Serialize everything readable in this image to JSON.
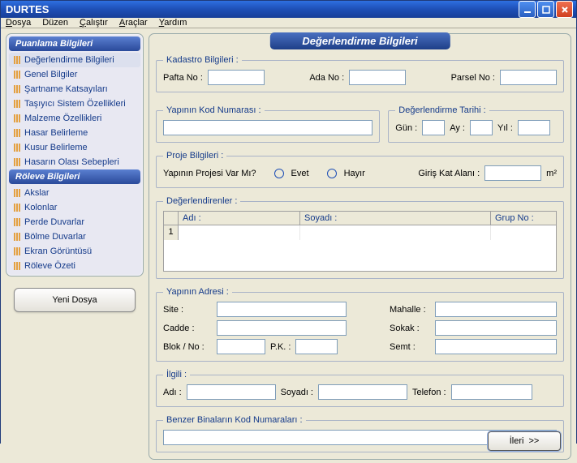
{
  "window": {
    "title": "DURTES"
  },
  "menu": [
    "osya",
    "Düzen",
    "alıştır",
    "raçlar",
    "ardım"
  ],
  "sidebar": {
    "groups": [
      {
        "title": "Puanlama Bilgileri",
        "items": [
          "Değerlendirme Bilgileri",
          "Genel Bilgiler",
          "Şartname Katsayıları",
          "Taşıyıcı Sistem Özellikleri",
          "Malzeme Özellikleri",
          "Hasar Belirleme",
          "Kusur Belirleme",
          "Hasarın Olası Sebepleri"
        ]
      },
      {
        "title": "Röleve Bilgileri",
        "items": [
          "Akslar",
          "Kolonlar",
          "Perde Duvarlar",
          "Bölme Duvarlar",
          "Ekran Görüntüsü",
          "Röleve Özeti"
        ]
      }
    ],
    "new_button": "Yeni Dosya"
  },
  "main": {
    "title": "Değerlendirme Bilgileri",
    "kadastro": {
      "legend": "Kadastro Bilgileri :",
      "pafta": "Pafta No :",
      "ada": "Ada No :",
      "parsel": "Parsel No :"
    },
    "yapikod": {
      "legend": "Yapının Kod Numarası :"
    },
    "tarih": {
      "legend": "Değerlendirme Tarihi :",
      "gun": "Gün :",
      "ay": "Ay :",
      "yil": "Yıl :"
    },
    "proje": {
      "legend": "Proje Bilgileri :",
      "question": "Yapının Projesi Var Mı?",
      "evet": "Evet",
      "hayir": "Hayır",
      "giris_kat": "Giriş Kat Alanı :",
      "unit": "m²"
    },
    "degerlendirenler": {
      "legend": "Değerlendirenler :",
      "cols": [
        "Adı :",
        "Soyadı :",
        "Grup No :"
      ],
      "row": "1"
    },
    "adres": {
      "legend": "Yapının Adresi :",
      "site": "Site :",
      "mahalle": "Mahalle :",
      "cadde": "Cadde :",
      "sokak": "Sokak :",
      "blok": "Blok / No :",
      "pk": "P.K. :",
      "semt": "Semt :"
    },
    "ilgili": {
      "legend": "İlgili :",
      "adi": "Adı :",
      "soyadi": "Soyadı :",
      "telefon": "Telefon :"
    },
    "benzer": {
      "legend": "Benzer Binaların Kod Numaraları :"
    },
    "next": "İleri"
  }
}
